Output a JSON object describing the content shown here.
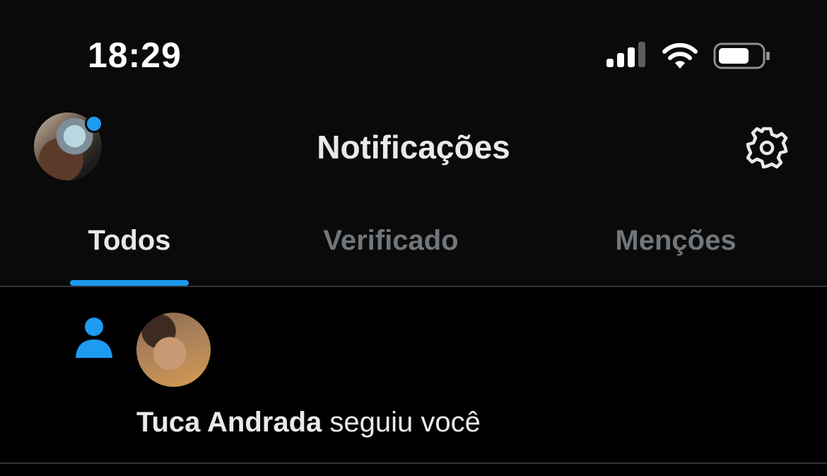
{
  "status_bar": {
    "time": "18:29",
    "signal_icon": "cellular-signal-icon",
    "wifi_icon": "wifi-icon",
    "battery_icon": "battery-icon"
  },
  "header": {
    "title": "Notificações",
    "avatar": "profile-avatar",
    "settings_icon": "gear-icon"
  },
  "tabs": [
    {
      "label": "Todos",
      "active": true
    },
    {
      "label": "Verificado",
      "active": false
    },
    {
      "label": "Menções",
      "active": false
    }
  ],
  "notifications": [
    {
      "type_icon": "person-icon",
      "user_name": "Tuca Andrada",
      "action": " seguiu você"
    }
  ],
  "colors": {
    "accent": "#1d9bf0",
    "background": "#000000",
    "header_bg": "#0a0a0a",
    "text_primary": "#e7e9ea",
    "text_muted": "#71767b",
    "divider": "#2f3336"
  }
}
